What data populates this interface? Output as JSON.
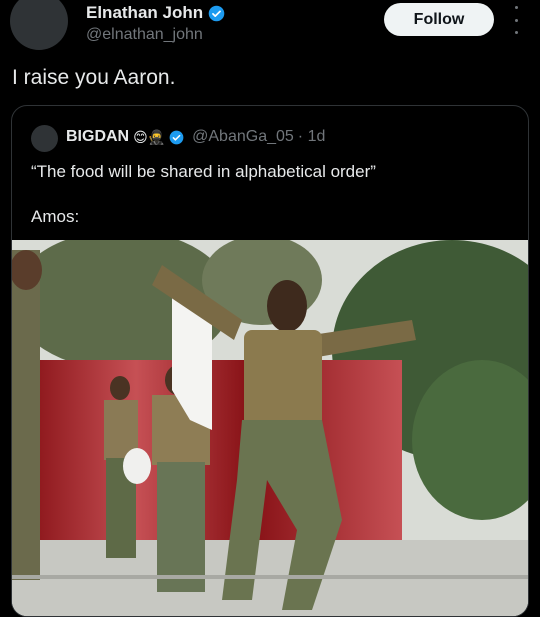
{
  "author": {
    "name": "Elnathan John",
    "handle": "@elnathan_john",
    "verified_icon": "verified-badge-icon"
  },
  "follow_label": "Follow",
  "more_icon": "more-options-icon",
  "tweet_text": "I raise you Aaron.",
  "quote": {
    "name": "BIGDAN",
    "emojis": "😊🥷",
    "handle": "@AbanGa_05",
    "time": "· 1d",
    "text": "“The food will be shared in alphabetical order”",
    "caption": "Amos:"
  },
  "colors": {
    "background": "#000000",
    "text": "#e7e9ea",
    "secondary": "#71767b",
    "verified": "#1d9bf0",
    "border": "#2f3336"
  }
}
